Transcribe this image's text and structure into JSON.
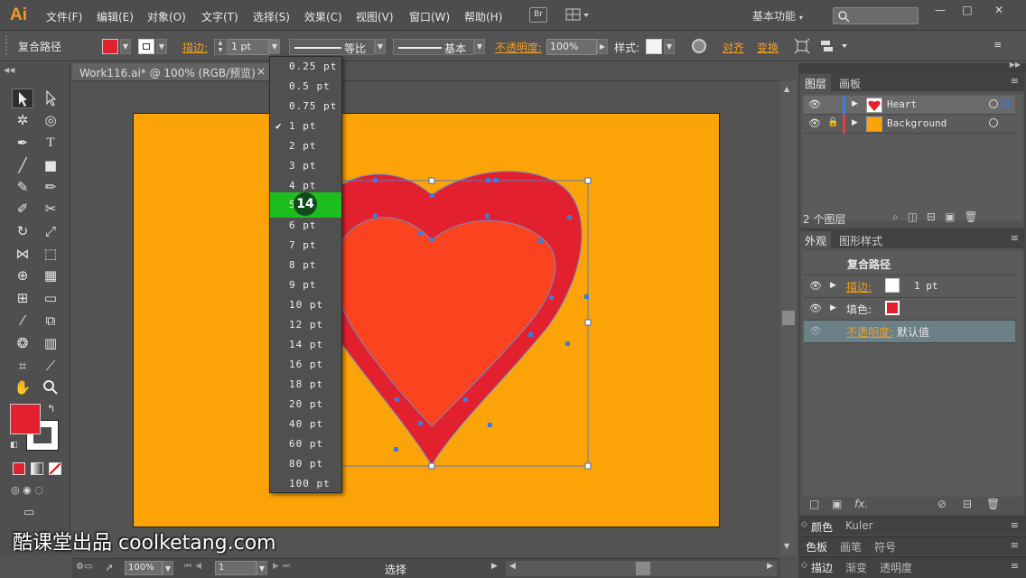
{
  "app": {
    "logo": "Ai",
    "workspace": "基本功能"
  },
  "menu": [
    "文件(F)",
    "编辑(E)",
    "对象(O)",
    "文字(T)",
    "选择(S)",
    "效果(C)",
    "视图(V)",
    "窗口(W)",
    "帮助(H)"
  ],
  "bridge_label": "Br",
  "window_controls": [
    "—",
    "□",
    "✕"
  ],
  "control_bar": {
    "selection_label": "复合路径",
    "stroke_label": "描边:",
    "stroke_weight": "1 pt",
    "profile_label": "等比",
    "brush_label": "基本",
    "opacity_label": "不透明度:",
    "opacity_value": "100%",
    "style_label": "样式:",
    "align_label": "对齐",
    "transform_label": "变换",
    "fill_color": "#e3202e",
    "stroke_color": "#ffffff"
  },
  "document": {
    "tab_title": "Work116.ai* @ 100% (RGB/预览)",
    "tab_close": "×",
    "artboard_color": "#fca307"
  },
  "stroke_weight_dropdown": {
    "options": [
      "0.25 pt",
      "0.5 pt",
      "0.75 pt",
      "1 pt",
      "2 pt",
      "3 pt",
      "4 pt",
      "5 pt",
      "6 pt",
      "7 pt",
      "8 pt",
      "9 pt",
      "10 pt",
      "12 pt",
      "14 pt",
      "16 pt",
      "18 pt",
      "20 pt",
      "40 pt",
      "60 pt",
      "80 pt",
      "100 pt"
    ],
    "checked": "1 pt",
    "highlighted": "5 pt",
    "click_indicator": "14"
  },
  "layers_panel": {
    "tabs": [
      "图层",
      "画板"
    ],
    "layers": [
      {
        "name": "Heart",
        "color": "#3c7be0",
        "thumb": "heart-thumb"
      },
      {
        "name": "Background",
        "color": "#e04040",
        "thumb": "orange-thumb"
      }
    ],
    "footer_count": "2 个图层"
  },
  "appearance_panel": {
    "tabs": [
      "外观",
      "图形样式"
    ],
    "header": "复合路径",
    "rows": [
      {
        "label": "描边:",
        "value": "1 pt"
      },
      {
        "label": "填色:",
        "value": ""
      },
      {
        "label": "不透明度:",
        "value": "默认值"
      }
    ],
    "fx_label": "fx."
  },
  "collapsed_panels": [
    [
      "颜色",
      "Kuler"
    ],
    [
      "色板",
      "画笔",
      "符号"
    ],
    [
      "描边",
      "渐变",
      "透明度"
    ]
  ],
  "status_bar": {
    "zoom": "100%",
    "artboard_index": "1",
    "tool_name": "选择"
  },
  "watermark": "酷课堂出品 coolketang.com",
  "heart": {
    "stroke_color": "#e3202e",
    "fill_color": "#fc4320"
  }
}
